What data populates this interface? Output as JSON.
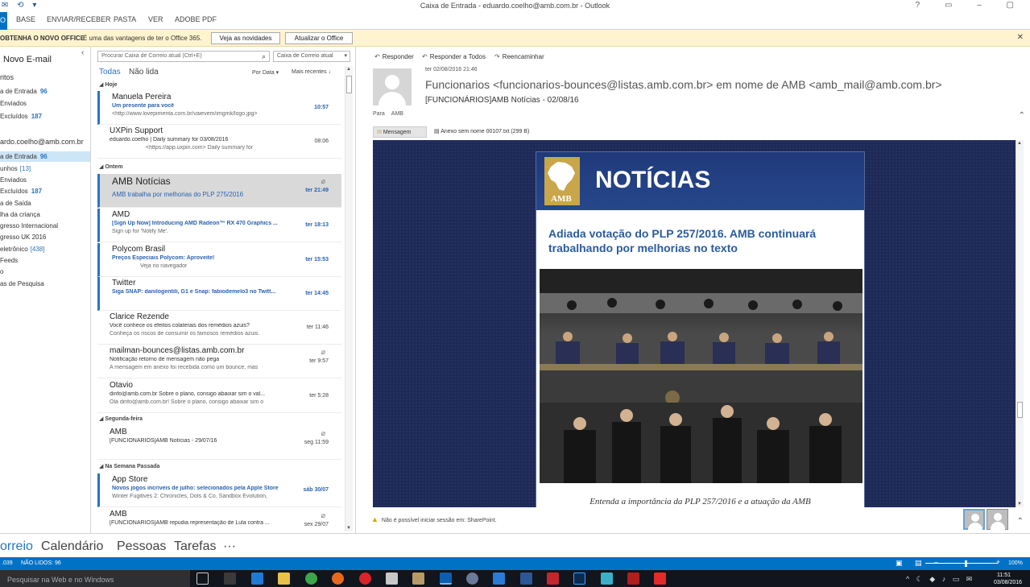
{
  "window": {
    "title": "Caixa de Entrada - eduardo.coelho@amb.com.br - Outlook",
    "controls": [
      "?",
      "▭",
      "–",
      "▢"
    ]
  },
  "ribbon": {
    "file_tab": "O",
    "tabs": [
      "BASE",
      "ENVIAR/RECEBER",
      "PASTA",
      "VER",
      "ADOBE PDF"
    ]
  },
  "infobar": {
    "label": "OBTENHA O NOVO OFFICE",
    "message": "É uma das vantagens de ter o Office 365.",
    "button_news": "Veja as novidades",
    "button_update": "Atualizar o Office"
  },
  "nav": {
    "new_email": "Novo E-mail",
    "favorites": [
      {
        "label": "ritos",
        "count": ""
      },
      {
        "label": "a de Entrada",
        "count": "96"
      },
      {
        "label": "Enviados",
        "count": ""
      },
      {
        "label": "Excluídos",
        "count": "187"
      }
    ],
    "account": "ardo.coelho@amb.com.br",
    "folders": [
      {
        "label": "a de Entrada",
        "count": "96",
        "style": "bold"
      },
      {
        "label": "unhos",
        "count": "[13]",
        "style": "bracket"
      },
      {
        "label": "Enviados",
        "count": "",
        "style": ""
      },
      {
        "label": "Excluídos",
        "count": "187",
        "style": "bold"
      },
      {
        "label": "a de Saída",
        "count": "",
        "style": ""
      },
      {
        "label": "lha da criança",
        "count": "",
        "style": ""
      },
      {
        "label": "gresso Internacional",
        "count": "",
        "style": ""
      },
      {
        "label": "gresso UK 2016",
        "count": "",
        "style": ""
      },
      {
        "label": "eletrônico",
        "count": "[438]",
        "style": "bracket"
      },
      {
        "label": "Feeds",
        "count": "",
        "style": ""
      },
      {
        "label": "o",
        "count": "",
        "style": ""
      },
      {
        "label": "as de Pesquisa",
        "count": "",
        "style": ""
      }
    ]
  },
  "list": {
    "search_placeholder": "Procurar Caixa de Correio atual (Ctrl+E)",
    "scope": "Caixa de Correio atual",
    "filter_all": "Todas",
    "filter_unread": "Não lida",
    "sort_by": "Por Data",
    "sort_order": "Mais recentes",
    "groups": {
      "today": "Hoje",
      "yesterday": "Ontem",
      "monday": "Segunda-feira",
      "last_week": "Na Semana Passada"
    },
    "items": [
      {
        "from": "Manuela Pereira",
        "subject": "Um presente para você",
        "preview": "<http://www.lovepimenta.com.br/vaievem/imgmk/logo.jpg>",
        "time": "10:57"
      },
      {
        "from": "UXPin Support",
        "subject": "eduardo.coelho | Daily summary for 03/08/2016",
        "preview": "<https://app.uxpin.com>    Daily summary for",
        "time": "08:06"
      },
      {
        "from": "AMB Notícias",
        "subject": "AMB trabalha por melhorias do PLP 275/2016",
        "preview": "",
        "time": "ter 21:49"
      },
      {
        "from": "AMD",
        "subject": "[Sign Up Now] Introducing AMD Radeon™ RX 470 Graphics ...",
        "preview": "Sign up for 'Notify Me'.",
        "time": "ter 18:13"
      },
      {
        "from": "Polycom Brasil",
        "subject": "Preços Especiais Polycom: Aproveite!",
        "preview": "Veja no navegador",
        "time": "ter 15:53"
      },
      {
        "from": "Twitter",
        "subject": "Siga SNAP: danilogentili, G1 e Snap: fabiodemelo3 no Twitt...",
        "preview": "",
        "time": "ter 14:45"
      },
      {
        "from": "Clarice Rezende",
        "subject": "Você conhece os efeitos colaterais dos remédios azuis?",
        "preview": "Conheça os riscos de consumir os famosos remédios azuis.",
        "time": "ter 11:46"
      },
      {
        "from": "mailman-bounces@listas.amb.com.br",
        "subject": "Notificação retorno de mensagem não pega",
        "preview": "A mensagem em anexo foi recebida como um bounce, mas",
        "time": "ter 9:57"
      },
      {
        "from": "Otavio",
        "subject": "dinfo@amb.com.br Sobre o plano, consigo abaixar sim o val...",
        "preview": "Olá dinfo@amb.com.br!  Sobre o plano, consigo abaixar sim o",
        "time": "ter 5:28"
      },
      {
        "from": "AMB",
        "subject": "[FUNCIONÁRIOS]AMB Notícias - 29/07/16",
        "preview": "",
        "time": "seg 11:59"
      },
      {
        "from": "App Store",
        "subject": "Novos jogos incríveis de julho: selecionados pela Apple Store",
        "preview": "Winter Fugitives 2: Chronicles, Dots & Co, Sandbox Evolution,",
        "time": "sáb 30/07"
      },
      {
        "from": "AMB",
        "subject": "[FUNCIONÁRIOS]AMB repudia representação de Lula contra ...",
        "preview": "",
        "time": "sex 29/07"
      }
    ]
  },
  "reading": {
    "actions": {
      "reply": "Responder",
      "reply_all": "Responder a Todos",
      "forward": "Reencaminhar"
    },
    "date": "ter 02/08/2016 21:46",
    "from": "Funcionarios <funcionarios-bounces@listas.amb.com.br> em nome de AMB <amb_mail@amb.com.br>",
    "subject": "[FUNCIONÁRIOS]AMB Notícias - 02/08/16",
    "to_label": "Para",
    "to_value": "AMB",
    "attachment_message": "Mensagem",
    "attachment_file": "Anexo sem nome 00107.txt (299 B)",
    "newsletter": {
      "logo_text": "AMB",
      "title": "NOTÍCIAS",
      "headline": "Adiada votação do PLP 257/2016. AMB continuará trabalhando por melhorias no texto",
      "caption": "Entenda a importância da PLP 257/2016 e a atuação da AMB"
    },
    "sharepoint_notice": "Não é possível iniciar sessão em: SharePoint."
  },
  "modules": {
    "mail": "orreio",
    "calendar": "Calendário",
    "people": "Pessoas",
    "tasks": "Tarefas",
    "more": "···"
  },
  "status": {
    "items": ".039",
    "unread": "NÃO LIDOS: 96",
    "zoom": "100%"
  },
  "taskbar": {
    "search_placeholder": "Pesquisar na Web e no Windows",
    "time": "11:51",
    "date": "03/08/2016"
  },
  "colors": {
    "accent": "#0072c6",
    "link_blue": "#2a62b0",
    "infobar": "#fff4ce",
    "newsletter_blue": "#1f3a7a"
  }
}
